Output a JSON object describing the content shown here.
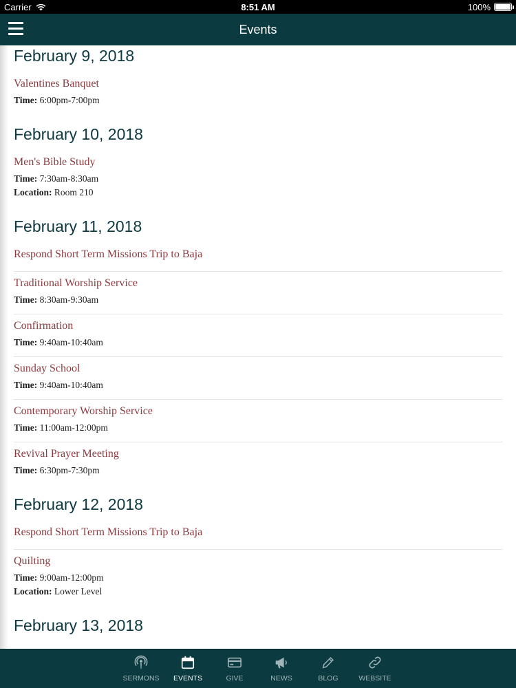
{
  "status_bar": {
    "carrier": "Carrier",
    "time": "8:51 AM",
    "battery": "100%"
  },
  "nav": {
    "title": "Events"
  },
  "labels": {
    "time": "Time:",
    "location": "Location:"
  },
  "days": [
    {
      "date": "February 9, 2018",
      "events": [
        {
          "title": "Valentines Banquet",
          "time": "6:00pm-7:00pm"
        }
      ]
    },
    {
      "date": "February 10, 2018",
      "events": [
        {
          "title": "Men's Bible Study",
          "time": "7:30am-8:30am",
          "location": "Room 210"
        }
      ]
    },
    {
      "date": "February 11, 2018",
      "events": [
        {
          "title": "Respond Short Term Missions Trip to Baja"
        },
        {
          "title": "Traditional Worship Service",
          "time": "8:30am-9:30am"
        },
        {
          "title": "Confirmation",
          "time": "9:40am-10:40am"
        },
        {
          "title": "Sunday School",
          "time": "9:40am-10:40am"
        },
        {
          "title": "Contemporary Worship Service",
          "time": "11:00am-12:00pm"
        },
        {
          "title": "Revival Prayer Meeting",
          "time": "6:30pm-7:30pm"
        }
      ]
    },
    {
      "date": "February 12, 2018",
      "events": [
        {
          "title": "Respond Short Term Missions Trip to Baja"
        },
        {
          "title": "Quilting",
          "time": "9:00am-12:00pm",
          "location": "Lower Level"
        }
      ]
    },
    {
      "date": "February 13, 2018",
      "events": []
    }
  ],
  "tabs": [
    {
      "label": "SERMONS",
      "icon": "podcast-icon",
      "active": false
    },
    {
      "label": "EVENTS",
      "icon": "calendar-icon",
      "active": true
    },
    {
      "label": "GIVE",
      "icon": "credit-card-icon",
      "active": false
    },
    {
      "label": "NEWS",
      "icon": "megaphone-icon",
      "active": false
    },
    {
      "label": "BLOG",
      "icon": "pencil-icon",
      "active": false
    },
    {
      "label": "WEBSITE",
      "icon": "link-icon",
      "active": false
    }
  ]
}
